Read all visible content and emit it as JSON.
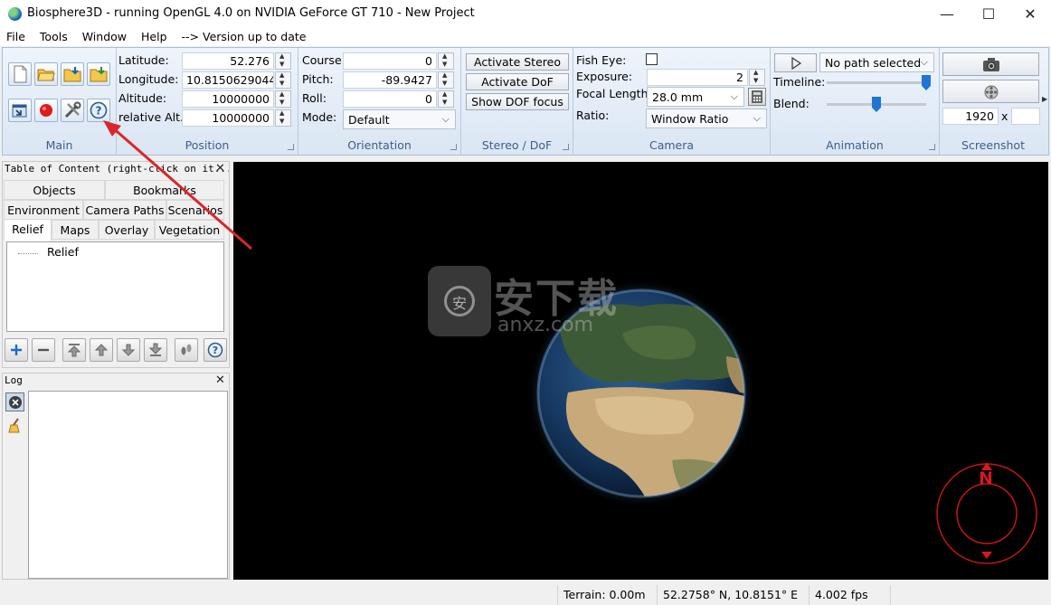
{
  "window": {
    "title": "Biosphere3D - running OpenGL 4.0 on NVIDIA GeForce GT 710 - New Project",
    "minimize_glyph": "—",
    "maximize_glyph": "☐",
    "close_glyph": "✕"
  },
  "menu": [
    "File",
    "Tools",
    "Window",
    "Help",
    "--> Version up to date"
  ],
  "ribbon": {
    "main": {
      "label": "Main"
    },
    "position": {
      "label": "Position",
      "fields": [
        {
          "label": "Latitude:",
          "value": "52.276"
        },
        {
          "label": "Longitude:",
          "value": "10.8150629044"
        },
        {
          "label": "Altitude:",
          "value": "10000000"
        },
        {
          "label": "relative Alt.:",
          "value": "10000000"
        }
      ]
    },
    "orientation": {
      "label": "Orientation",
      "course_label": "Course:",
      "course_value": "0",
      "pitch_label": "Pitch:",
      "pitch_value": "-89.9427",
      "roll_label": "Roll:",
      "roll_value": "0",
      "mode_label": "Mode:",
      "mode_value": "Default"
    },
    "stereo": {
      "label": "Stereo / DoF",
      "activate_stereo": "Activate Stereo",
      "activate_dof": "Activate DoF",
      "show_dof_focus": "Show DOF focus"
    },
    "camera": {
      "label": "Camera",
      "fisheye_label": "Fish Eye:",
      "fisheye_checked": false,
      "exposure_label": "Exposure:",
      "exposure_value": "2",
      "focal_label": "Focal Length:",
      "focal_value": "28.0 mm",
      "ratio_label": "Ratio:",
      "ratio_value": "Window Ratio"
    },
    "animation": {
      "label": "Animation",
      "path_select": "No path selected",
      "timeline_label": "Timeline:",
      "timeline_level": 1.0,
      "blend_label": "Blend:",
      "blend_level": 0.5
    },
    "screenshot": {
      "label": "Screenshot",
      "width_value": "1920",
      "x_label": "x"
    }
  },
  "toc": {
    "title": "Table of Content (right-click on it...",
    "tab_rows": [
      [
        "Objects",
        "Bookmarks"
      ],
      [
        "Environment",
        "Camera Paths",
        "Scenarios"
      ],
      [
        "Relief",
        "Maps",
        "Overlay",
        "Vegetation"
      ]
    ],
    "active_tab": "Relief",
    "tree": [
      "Relief"
    ]
  },
  "log": {
    "title": "Log"
  },
  "viewport": {
    "compass_letter": "N",
    "watermark_cn": "安下载",
    "watermark_en": "anxz.com",
    "watermark_badge": "安"
  },
  "status": {
    "terrain": "Terrain: 0.00m",
    "coords": "52.2758° N, 10.8151° E",
    "fps": "4.002 fps"
  },
  "colors": {
    "annotation_arrow": "#d9262b",
    "compass": "#c81414",
    "ribbon_label": "#3b5f89"
  }
}
